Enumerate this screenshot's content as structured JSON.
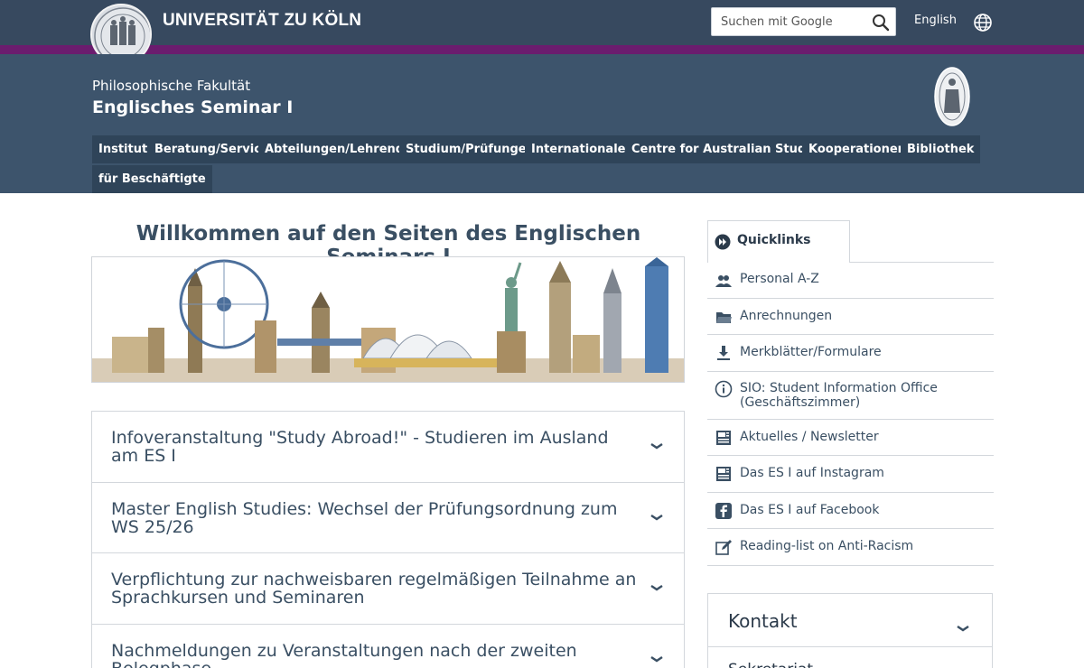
{
  "header": {
    "university": "UNIVERSITÄT ZU KÖLN",
    "search_placeholder": "Suchen mit Google",
    "language": "English",
    "faculty": "Philosophische Fakultät",
    "seminar": "Englisches Seminar I"
  },
  "nav": {
    "items": [
      "Institut",
      "Beratung/Service",
      "Abteilungen/Lehrende",
      "Studium/Prüfungen",
      "Internationales",
      "Centre for Australian Studies",
      "Kooperationen",
      "Bibliothek",
      "für Beschäftigte"
    ]
  },
  "main": {
    "title": "Willkommen auf den Seiten des Englischen Seminars I",
    "accordions": [
      "Infoveranstaltung \"Study Abroad!\" - Studieren im Ausland am ES I",
      "Master English Studies: Wechsel der Prüfungsordnung zum WS 25/26",
      "Verpflichtung zur nachweisbaren regelmäßigen Teilnahme an Sprachkursen und Seminaren",
      "Nachmeldungen zu Veranstaltungen nach der zweiten Belegphase"
    ]
  },
  "sidebar": {
    "quicklinks_label": "Quicklinks",
    "links": [
      {
        "label": "Personal A-Z",
        "icon": "people-icon"
      },
      {
        "label": "Anrechnungen",
        "icon": "folder-icon"
      },
      {
        "label": "Merkblätter/Formulare",
        "icon": "download-icon"
      },
      {
        "label": "SIO: Student Information Office (Geschäftszimmer)",
        "icon": "info-icon"
      },
      {
        "label": "Aktuelles / Newsletter",
        "icon": "newspaper-icon"
      },
      {
        "label": "Das ES I auf Instagram",
        "icon": "newspaper-icon"
      },
      {
        "label": "Das ES I auf Facebook",
        "icon": "facebook-icon"
      },
      {
        "label": "Reading-list on Anti-Racism",
        "icon": "edit-icon"
      }
    ],
    "contact_title": "Kontakt",
    "contact_subtitle": "Sekretariat"
  },
  "colors": {
    "topbar": "#37495f",
    "accent_purple": "#6b1c6e",
    "header_band": "#3d546c",
    "nav_item": "#2f4459"
  }
}
